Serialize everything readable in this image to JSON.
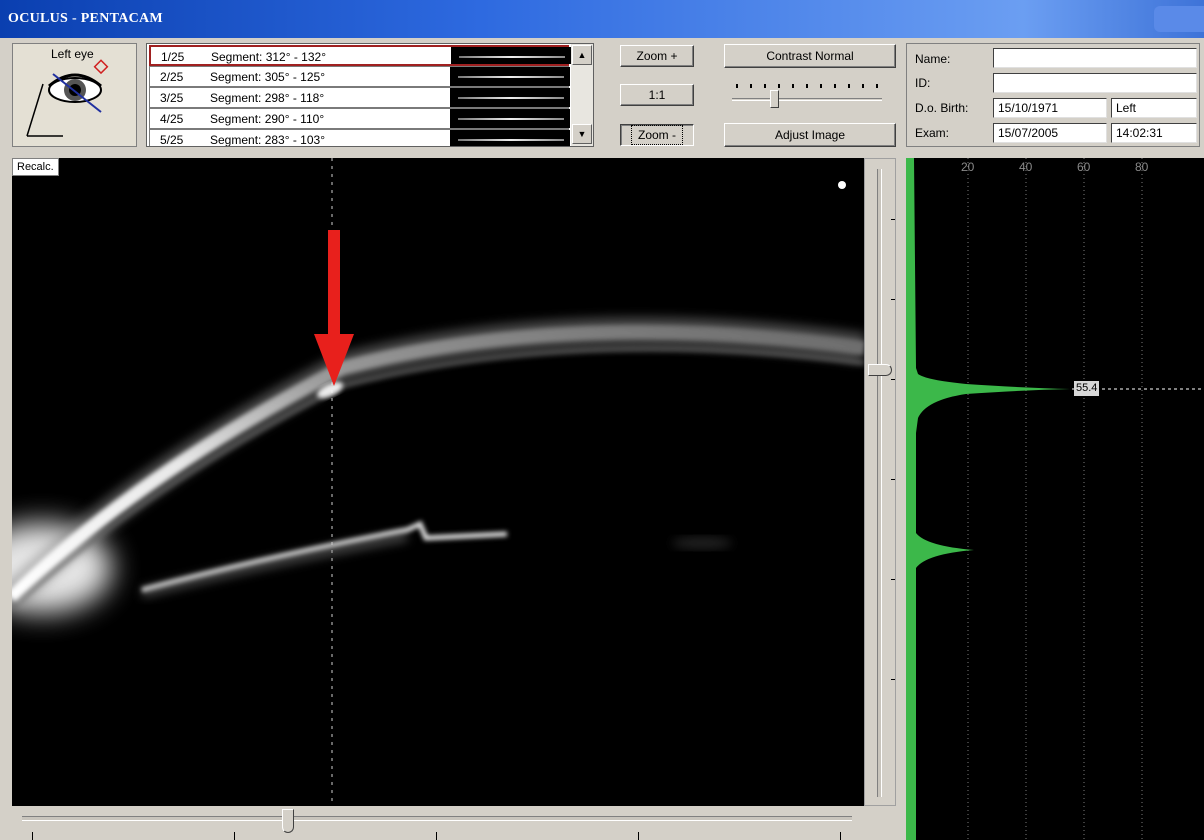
{
  "window": {
    "title": "OCULUS  -  PENTACAM"
  },
  "eye_panel": {
    "label": "Left eye"
  },
  "segments": [
    {
      "num": "1/25",
      "label": "Segment: 312° - 132°"
    },
    {
      "num": "2/25",
      "label": "Segment: 305° - 125°"
    },
    {
      "num": "3/25",
      "label": "Segment: 298° - 118°"
    },
    {
      "num": "4/25",
      "label": "Segment: 290° - 110°"
    },
    {
      "num": "5/25",
      "label": "Segment: 283° - 103°"
    }
  ],
  "controls": {
    "zoom_plus": "Zoom +",
    "one_to_one": "1:1",
    "zoom_minus": "Zoom -",
    "contrast": "Contrast Normal",
    "adjust": "Adjust Image"
  },
  "patient": {
    "name_label": "Name:",
    "name_value": "",
    "id_label": "ID:",
    "id_value": "",
    "dob_label": "D.o. Birth:",
    "dob_value": "15/10/1971",
    "eye_value": "Left",
    "exam_label": "Exam:",
    "exam_date": "15/07/2005",
    "exam_time": "14:02:31"
  },
  "image": {
    "recalc": "Recalc."
  },
  "density": {
    "ticks": [
      "20",
      "40",
      "60",
      "80"
    ],
    "peak_value": "55.4"
  },
  "colors": {
    "title_bar": "#2e6ae0",
    "density_fill": "#3cb84a",
    "arrow": "#e8201c"
  },
  "icons": {
    "eye": "eye-icon",
    "arrow": "arrow-down-icon"
  }
}
